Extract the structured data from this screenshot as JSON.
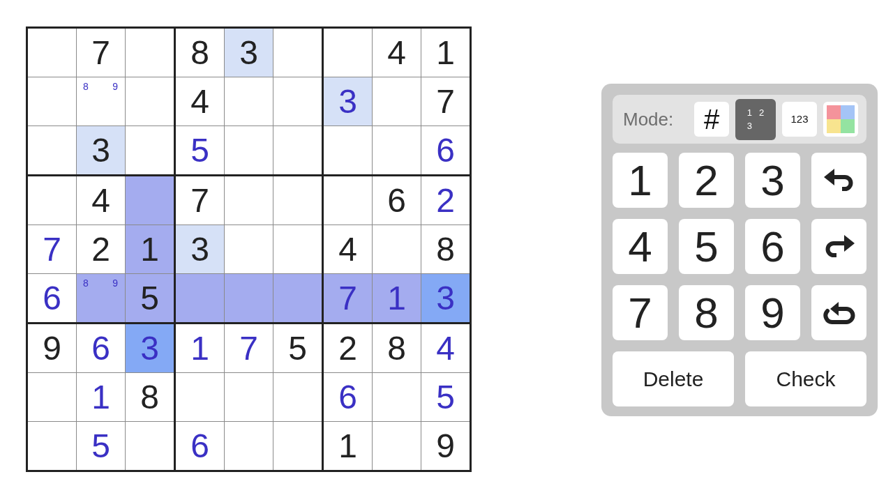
{
  "grid": {
    "rows": [
      [
        {
          "kind": "empty",
          "selected": false,
          "highlighted": false
        },
        {
          "kind": "given",
          "value": "7",
          "selected": false,
          "highlighted": false
        },
        {
          "kind": "empty",
          "selected": false,
          "highlighted": false
        },
        {
          "kind": "given",
          "value": "8",
          "selected": false,
          "highlighted": false
        },
        {
          "kind": "given",
          "value": "3",
          "selected": false,
          "highlighted": true
        },
        {
          "kind": "empty",
          "selected": false,
          "highlighted": false
        },
        {
          "kind": "empty",
          "selected": false,
          "highlighted": false
        },
        {
          "kind": "given",
          "value": "4",
          "selected": false,
          "highlighted": false
        },
        {
          "kind": "given",
          "value": "1",
          "selected": false,
          "highlighted": false
        }
      ],
      [
        {
          "kind": "empty",
          "selected": false,
          "highlighted": false
        },
        {
          "kind": "notes",
          "notes": [
            "8",
            "9"
          ],
          "selected": false,
          "highlighted": false
        },
        {
          "kind": "empty",
          "selected": false,
          "highlighted": false
        },
        {
          "kind": "given",
          "value": "4",
          "selected": false,
          "highlighted": false
        },
        {
          "kind": "empty",
          "selected": false,
          "highlighted": false
        },
        {
          "kind": "empty",
          "selected": false,
          "highlighted": false
        },
        {
          "kind": "entered",
          "value": "3",
          "selected": false,
          "highlighted": true
        },
        {
          "kind": "empty",
          "selected": false,
          "highlighted": false
        },
        {
          "kind": "given",
          "value": "7",
          "selected": false,
          "highlighted": false
        }
      ],
      [
        {
          "kind": "empty",
          "selected": false,
          "highlighted": false
        },
        {
          "kind": "given",
          "value": "3",
          "selected": false,
          "highlighted": true
        },
        {
          "kind": "empty",
          "selected": false,
          "highlighted": false
        },
        {
          "kind": "entered",
          "value": "5",
          "selected": false,
          "highlighted": false
        },
        {
          "kind": "empty",
          "selected": false,
          "highlighted": false
        },
        {
          "kind": "empty",
          "selected": false,
          "highlighted": false
        },
        {
          "kind": "empty",
          "selected": false,
          "highlighted": false
        },
        {
          "kind": "empty",
          "selected": false,
          "highlighted": false
        },
        {
          "kind": "entered",
          "value": "6",
          "selected": false,
          "highlighted": false
        }
      ],
      [
        {
          "kind": "empty",
          "selected": false,
          "highlighted": false
        },
        {
          "kind": "given",
          "value": "4",
          "selected": false,
          "highlighted": false
        },
        {
          "kind": "empty",
          "selected": true,
          "highlighted": false
        },
        {
          "kind": "given",
          "value": "7",
          "selected": false,
          "highlighted": false
        },
        {
          "kind": "empty",
          "selected": false,
          "highlighted": false
        },
        {
          "kind": "empty",
          "selected": false,
          "highlighted": false
        },
        {
          "kind": "empty",
          "selected": false,
          "highlighted": false
        },
        {
          "kind": "given",
          "value": "6",
          "selected": false,
          "highlighted": false
        },
        {
          "kind": "entered",
          "value": "2",
          "selected": false,
          "highlighted": false
        }
      ],
      [
        {
          "kind": "entered",
          "value": "7",
          "selected": false,
          "highlighted": false
        },
        {
          "kind": "given",
          "value": "2",
          "selected": false,
          "highlighted": false
        },
        {
          "kind": "given",
          "value": "1",
          "selected": true,
          "highlighted": false
        },
        {
          "kind": "given",
          "value": "3",
          "selected": false,
          "highlighted": true
        },
        {
          "kind": "empty",
          "selected": false,
          "highlighted": false
        },
        {
          "kind": "empty",
          "selected": false,
          "highlighted": false
        },
        {
          "kind": "given",
          "value": "4",
          "selected": false,
          "highlighted": false
        },
        {
          "kind": "empty",
          "selected": false,
          "highlighted": false
        },
        {
          "kind": "given",
          "value": "8",
          "selected": false,
          "highlighted": false
        }
      ],
      [
        {
          "kind": "entered",
          "value": "6",
          "selected": false,
          "highlighted": false
        },
        {
          "kind": "notes",
          "notes": [
            "8",
            "9"
          ],
          "selected": true,
          "highlighted": false
        },
        {
          "kind": "given",
          "value": "5",
          "selected": true,
          "highlighted": false
        },
        {
          "kind": "empty",
          "selected": true,
          "highlighted": false
        },
        {
          "kind": "empty",
          "selected": true,
          "highlighted": false
        },
        {
          "kind": "empty",
          "selected": true,
          "highlighted": false
        },
        {
          "kind": "entered",
          "value": "7",
          "selected": true,
          "highlighted": false
        },
        {
          "kind": "entered",
          "value": "1",
          "selected": true,
          "highlighted": false
        },
        {
          "kind": "entered",
          "value": "3",
          "selected": true,
          "highlighted": true
        }
      ],
      [
        {
          "kind": "given",
          "value": "9",
          "selected": false,
          "highlighted": false
        },
        {
          "kind": "entered",
          "value": "6",
          "selected": false,
          "highlighted": false
        },
        {
          "kind": "entered",
          "value": "3",
          "selected": true,
          "highlighted": true
        },
        {
          "kind": "entered",
          "value": "1",
          "selected": false,
          "highlighted": false
        },
        {
          "kind": "entered",
          "value": "7",
          "selected": false,
          "highlighted": false
        },
        {
          "kind": "given",
          "value": "5",
          "selected": false,
          "highlighted": false
        },
        {
          "kind": "given",
          "value": "2",
          "selected": false,
          "highlighted": false
        },
        {
          "kind": "given",
          "value": "8",
          "selected": false,
          "highlighted": false
        },
        {
          "kind": "entered",
          "value": "4",
          "selected": false,
          "highlighted": false
        }
      ],
      [
        {
          "kind": "empty",
          "selected": false,
          "highlighted": false
        },
        {
          "kind": "entered",
          "value": "1",
          "selected": false,
          "highlighted": false
        },
        {
          "kind": "given",
          "value": "8",
          "selected": false,
          "highlighted": false
        },
        {
          "kind": "empty",
          "selected": false,
          "highlighted": false
        },
        {
          "kind": "empty",
          "selected": false,
          "highlighted": false
        },
        {
          "kind": "empty",
          "selected": false,
          "highlighted": false
        },
        {
          "kind": "entered",
          "value": "6",
          "selected": false,
          "highlighted": false
        },
        {
          "kind": "empty",
          "selected": false,
          "highlighted": false
        },
        {
          "kind": "entered",
          "value": "5",
          "selected": false,
          "highlighted": false
        }
      ],
      [
        {
          "kind": "empty",
          "selected": false,
          "highlighted": false
        },
        {
          "kind": "entered",
          "value": "5",
          "selected": false,
          "highlighted": false
        },
        {
          "kind": "empty",
          "selected": false,
          "highlighted": false
        },
        {
          "kind": "entered",
          "value": "6",
          "selected": false,
          "highlighted": false
        },
        {
          "kind": "empty",
          "selected": false,
          "highlighted": false
        },
        {
          "kind": "empty",
          "selected": false,
          "highlighted": false
        },
        {
          "kind": "given",
          "value": "1",
          "selected": false,
          "highlighted": false
        },
        {
          "kind": "empty",
          "selected": false,
          "highlighted": false
        },
        {
          "kind": "given",
          "value": "9",
          "selected": false,
          "highlighted": false
        }
      ]
    ]
  },
  "panel": {
    "mode_label": "Mode:",
    "modes": [
      {
        "kind": "digit",
        "label": "#",
        "selected": false
      },
      {
        "kind": "corner",
        "labels": [
          "1",
          "2",
          "3"
        ],
        "selected": true
      },
      {
        "kind": "center",
        "label": "123",
        "selected": false
      },
      {
        "kind": "color",
        "selected": false
      }
    ],
    "keys": [
      {
        "kind": "digit",
        "label": "1"
      },
      {
        "kind": "digit",
        "label": "2"
      },
      {
        "kind": "digit",
        "label": "3"
      },
      {
        "kind": "undo"
      },
      {
        "kind": "digit",
        "label": "4"
      },
      {
        "kind": "digit",
        "label": "5"
      },
      {
        "kind": "digit",
        "label": "6"
      },
      {
        "kind": "redo"
      },
      {
        "kind": "digit",
        "label": "7"
      },
      {
        "kind": "digit",
        "label": "8"
      },
      {
        "kind": "digit",
        "label": "9"
      },
      {
        "kind": "restart"
      }
    ],
    "actions": [
      {
        "label": "Delete"
      },
      {
        "label": "Check"
      }
    ]
  }
}
